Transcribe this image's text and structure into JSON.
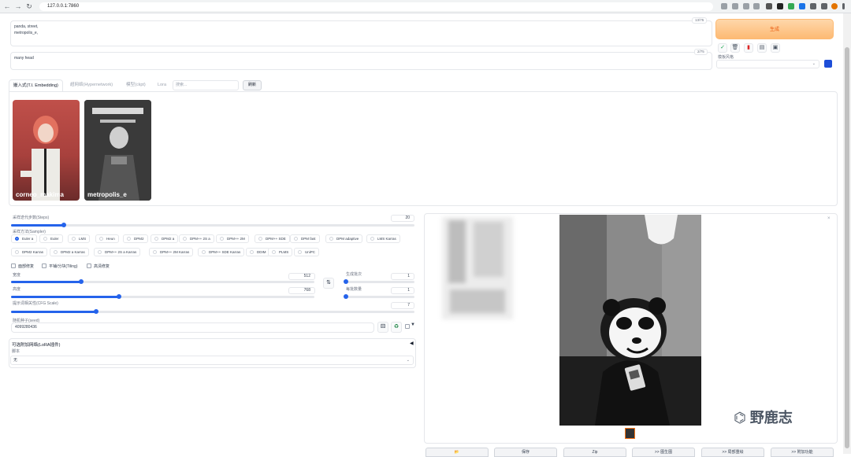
{
  "browser": {
    "url": "127.0.0.1:7860"
  },
  "prompt": {
    "positive_text": "panda, street,\nmetropolis_e,",
    "positive_counter": "13/75",
    "negative_text": "many head",
    "negative_counter": "2/75"
  },
  "actions": {
    "generate_label": "生成",
    "styles_label": "模板风格"
  },
  "extra_networks": {
    "tabs": [
      "嵌入式(T.I. Embedding)",
      "超网络(Hypernetwork)",
      "模型(ckpt)",
      "Lora"
    ],
    "search_placeholder": "搜索...",
    "refresh_label": "刷新",
    "cards": [
      {
        "name": "corneo_makima"
      },
      {
        "name": "metropolis_e"
      }
    ]
  },
  "settings": {
    "steps_label": "采样迭代步数(Steps)",
    "steps_value": "20",
    "sampler_label": "采样方法(Sampler)",
    "samplers": [
      "Euler a",
      "Euler",
      "LMS",
      "Heun",
      "DPM2",
      "DPM2 a",
      "DPM++ 2S a",
      "DPM++ 2M",
      "DPM++ SDE",
      "DPM fast",
      "DPM adaptive",
      "LMS Karras",
      "DPM2 Karras",
      "DPM2 a Karras",
      "DPM++ 2S a Karras",
      "DPM++ 2M Karras",
      "DPM++ SDE Karras",
      "DDIM",
      "PLMS",
      "UniPC"
    ],
    "selected_sampler": "Euler a",
    "checkboxes": [
      "面部修复",
      "平铺/分块(Tiling)",
      "高清修复"
    ],
    "width_label": "宽度",
    "width_value": "512",
    "height_label": "高度",
    "height_value": "768",
    "batch_count_label": "生成批次",
    "batch_count_value": "1",
    "batch_size_label": "每批数量",
    "batch_size_value": "1",
    "cfg_label": "提示词相关性(CFG Scale)",
    "cfg_value": "7",
    "seed_label": "随机种子(seed)",
    "seed_value": "4099280436",
    "lora_section_label": "可选附加网络(LoRA插件)",
    "script_label": "脚本",
    "script_value": "无"
  },
  "output": {
    "bottom_buttons": [
      "📂",
      "保存",
      "Zip",
      ">> 图生图",
      ">> 局部重绘",
      ">> 附加功能"
    ]
  },
  "watermark": {
    "text": "野鹿志"
  }
}
